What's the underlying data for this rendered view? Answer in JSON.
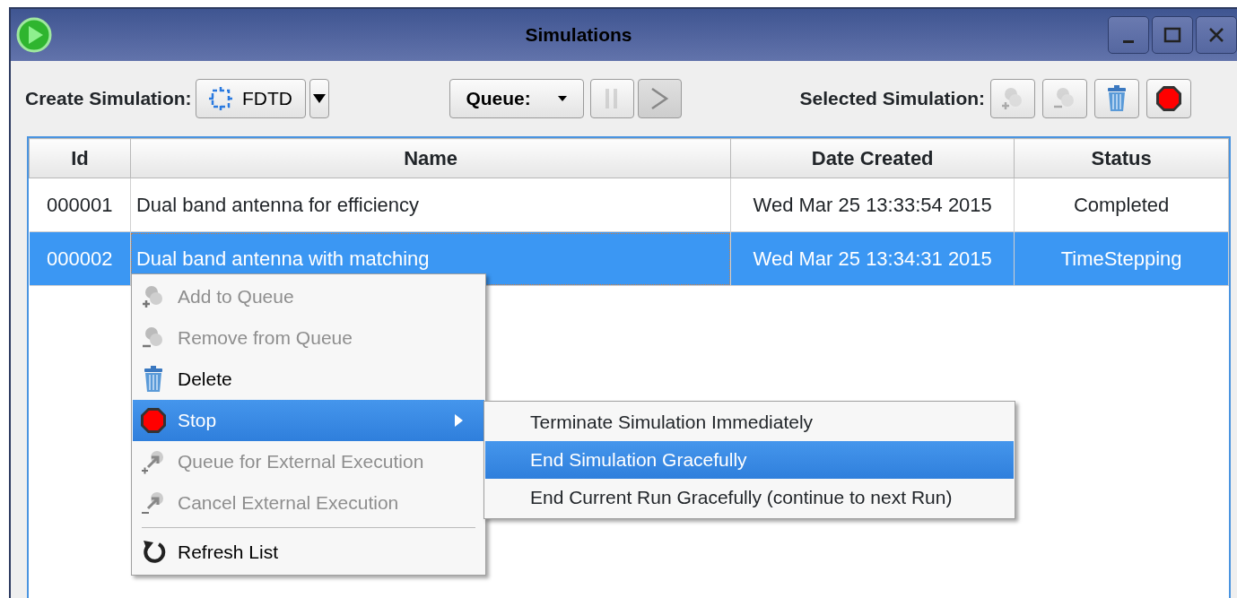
{
  "window": {
    "title": "Simulations",
    "controls": [
      {
        "kind": "minimize"
      },
      {
        "kind": "maximize"
      },
      {
        "kind": "close"
      }
    ]
  },
  "toolbar": {
    "create_label": "Create Simulation:",
    "create_button": {
      "label": "FDTD"
    },
    "queue_button": {
      "label": "Queue:"
    },
    "queue_controls": [
      {
        "kind": "pause",
        "disabled": true
      },
      {
        "kind": "play",
        "disabled": false
      }
    ],
    "selected_label": "Selected Simulation:",
    "selected_buttons": [
      {
        "kind": "add",
        "disabled": true
      },
      {
        "kind": "remove",
        "disabled": true
      },
      {
        "kind": "delete",
        "disabled": false
      },
      {
        "kind": "stop",
        "disabled": false
      }
    ]
  },
  "table": {
    "columns": [
      "Id",
      "Name",
      "Date Created",
      "Status"
    ],
    "rows": [
      {
        "cells": [
          "000001",
          "Dual band antenna for efficiency",
          "Wed Mar 25 13:33:54 2015",
          "Completed"
        ],
        "selected": false
      },
      {
        "cells": [
          "000002",
          "Dual band antenna with matching",
          "Wed Mar 25 13:34:31 2015",
          "TimeStepping"
        ],
        "selected": true
      }
    ]
  },
  "context_menu": {
    "items": [
      {
        "kind": "add",
        "label": "Add to Queue",
        "disabled": true,
        "selected": false,
        "has_submenu": false
      },
      {
        "kind": "remove",
        "label": "Remove from Queue",
        "disabled": true,
        "selected": false,
        "has_submenu": false
      },
      {
        "kind": "delete",
        "label": "Delete",
        "disabled": false,
        "selected": false,
        "has_submenu": false
      },
      {
        "kind": "stop",
        "label": "Stop",
        "disabled": false,
        "selected": true,
        "has_submenu": true
      },
      {
        "kind": "queue-ext",
        "label": "Queue for External Execution",
        "disabled": true,
        "selected": false,
        "has_submenu": false
      },
      {
        "kind": "cancel-ext",
        "label": "Cancel External Execution",
        "disabled": true,
        "selected": false,
        "has_submenu": false
      },
      {
        "kind": "separator"
      },
      {
        "kind": "refresh",
        "label": "Refresh List",
        "disabled": false,
        "selected": false,
        "has_submenu": false
      }
    ],
    "submenu": [
      {
        "label": "Terminate Simulation Immediately",
        "selected": false
      },
      {
        "label": "End Simulation Gracefully",
        "selected": true
      },
      {
        "label": "End Current Run Gracefully (continue to next Run)",
        "selected": false
      }
    ]
  }
}
